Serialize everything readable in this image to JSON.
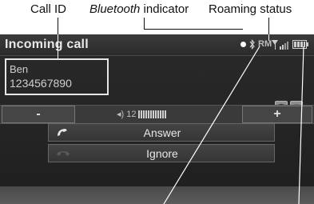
{
  "callouts": {
    "call_id": "Call ID",
    "bluetooth_word": "Bluetooth",
    "bluetooth_rest": " indicator",
    "roaming": "Roaming status"
  },
  "screen": {
    "title": "Incoming call",
    "status": {
      "roaming": "RM"
    },
    "caller": {
      "name": "Ben",
      "number": "1234567890"
    },
    "volume": {
      "minus": "-",
      "plus": "+",
      "level": "12"
    },
    "menu": [
      {
        "label": "Answer",
        "icon": "phone-answer-icon"
      },
      {
        "label": "Ignore",
        "icon": "phone-ignore-icon"
      }
    ]
  },
  "colors": {
    "screen_bg": "#232323",
    "text": "#e6e6e6",
    "highlight_box": "#e6e6e6"
  }
}
